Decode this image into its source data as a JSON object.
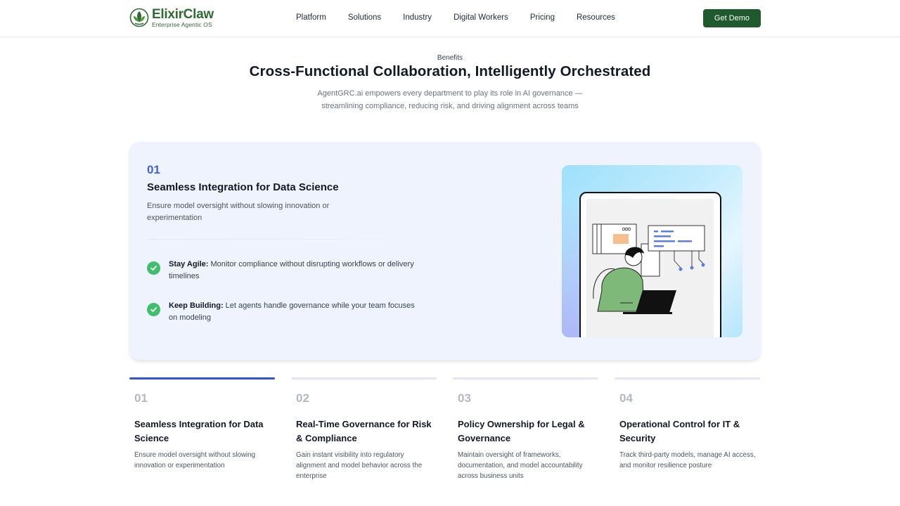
{
  "header": {
    "brand_name": "ElixirClaw",
    "brand_tagline": "Enterprise Agentic OS",
    "nav": [
      "Platform",
      "Solutions",
      "Industry",
      "Digital Workers",
      "Pricing",
      "Resources"
    ],
    "cta_label": "Get Demo"
  },
  "section": {
    "eyebrow": "Benefits",
    "title": "Cross-Functional Collaboration, Intelligently Orchestrated",
    "subtitle": "AgentGRC.ai empowers every department to play its role in AI governance —streamlining compliance, reducing risk, and driving alignment across teams"
  },
  "feature": {
    "number": "01",
    "title": "Seamless Integration for Data Science",
    "description": "Ensure model oversight without slowing innovation or experimentation",
    "points": [
      {
        "label": "Stay Agile:",
        "text": "Monitor compliance without disrupting workflows or delivery timelines"
      },
      {
        "label": "Keep Building:",
        "text": "Let agents handle governance while your team focuses on modeling"
      }
    ]
  },
  "tabs": [
    {
      "number": "01",
      "title": "Seamless Integration for Data Science",
      "description": "Ensure model oversight without slowing innovation or experimentation",
      "active": true
    },
    {
      "number": "02",
      "title": "Real-Time Governance for Risk & Compliance",
      "description": "Gain instant visibility into regulatory alignment and model behavior across the enterprise",
      "active": false
    },
    {
      "number": "03",
      "title": "Policy Ownership for Legal & Governance",
      "description": "Maintain oversight of frameworks, documentation, and model accountability across business units",
      "active": false
    },
    {
      "number": "04",
      "title": "Operational Control for IT & Security",
      "description": "Track third-party models, manage AI access, and monitor resilience posture",
      "active": false
    }
  ],
  "colors": {
    "brand_green": "#1e5a2d",
    "accent_blue": "#2f54d4",
    "check_green": "#3fbf6b",
    "card_bg": "#eff3fd"
  }
}
